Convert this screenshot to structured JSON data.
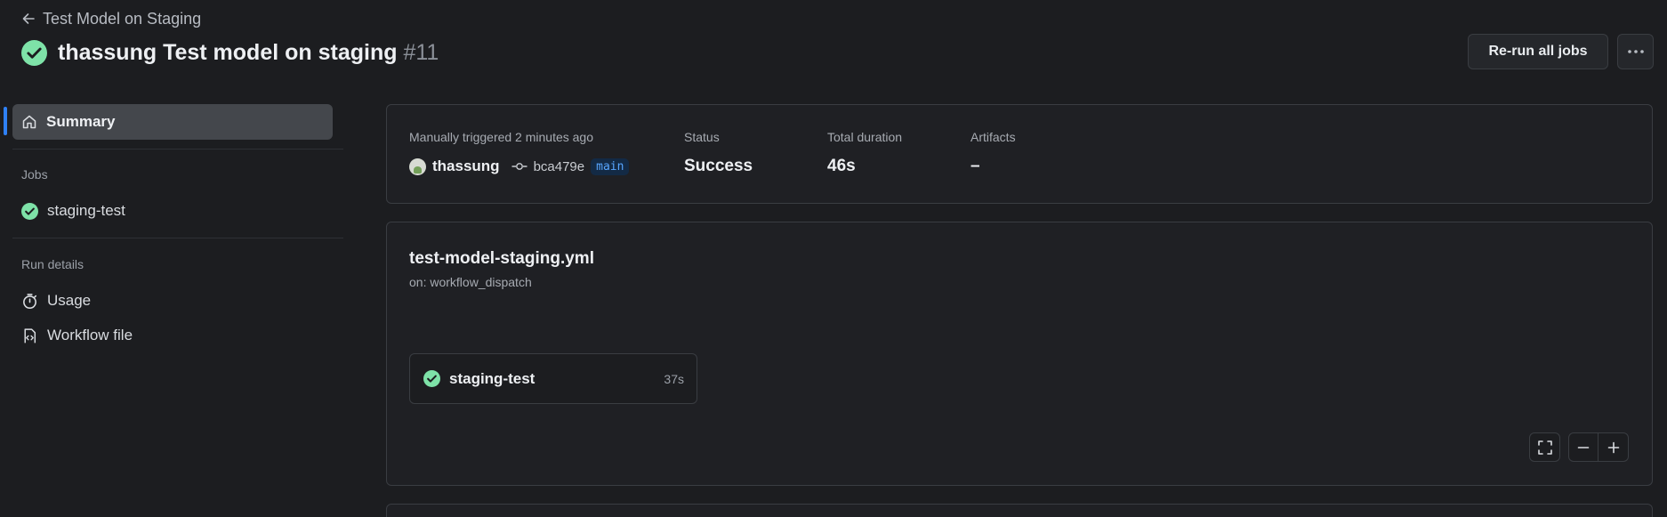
{
  "header": {
    "back_label": "Test Model on Staging",
    "title": "thassung Test model on staging",
    "run_number": "#11",
    "rerun_label": "Re-run all jobs"
  },
  "sidebar": {
    "summary_label": "Summary",
    "jobs_heading": "Jobs",
    "jobs": [
      {
        "label": "staging-test",
        "status": "success"
      }
    ],
    "run_details_heading": "Run details",
    "run_details": [
      {
        "label": "Usage",
        "icon": "stopwatch-icon"
      },
      {
        "label": "Workflow file",
        "icon": "file-code-icon"
      }
    ]
  },
  "summary": {
    "trigger_label": "Manually triggered 2 minutes ago",
    "actor": "thassung",
    "commit": "bca479e",
    "branch": "main",
    "status_label": "Status",
    "status_value": "Success",
    "duration_label": "Total duration",
    "duration_value": "46s",
    "artifacts_label": "Artifacts",
    "artifacts_value": "–"
  },
  "workflow": {
    "file_name": "test-model-staging.yml",
    "trigger": "on: workflow_dispatch",
    "job": {
      "name": "staging-test",
      "duration": "37s"
    }
  },
  "colors": {
    "background": "#1c1d20",
    "success": "#3fb950",
    "accent": "#2f81f7",
    "border": "#3a3d42"
  }
}
